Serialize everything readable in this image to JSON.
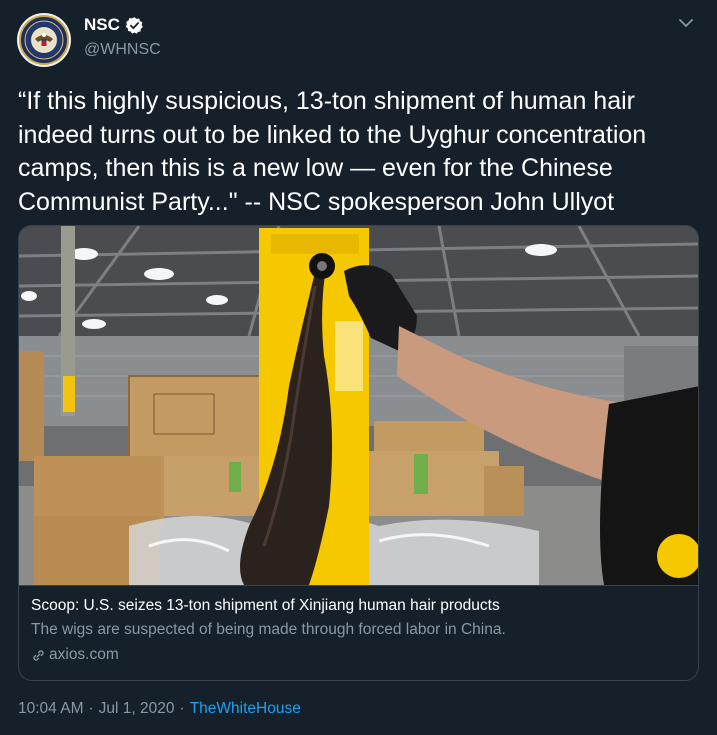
{
  "author": {
    "name": "NSC",
    "handle": "@WHNSC",
    "avatar_icon": "presidential-seal-icon",
    "verified_icon": "verified-badge-icon"
  },
  "tweet": {
    "text": "“If this highly suspicious, 13-ton shipment of human hair indeed turns out to be linked to the Uyghur concentration camps, then this is a new low — even for the Chinese Communist Party...\" -- NSC spokesperson John Ullyot"
  },
  "card": {
    "title": "Scoop: U.S. seizes 13-ton shipment of Xinjiang human hair products",
    "description": "The wigs are suspected of being made through forced labor in China.",
    "domain": "axios.com",
    "image_subject": "warehouse-hair-product-photo"
  },
  "meta": {
    "time": "10:04 AM",
    "separator1": "·",
    "date": "Jul 1, 2020",
    "separator2": "·",
    "source": "TheWhiteHouse"
  },
  "colors": {
    "background": "#15202b",
    "secondary_text": "#8899a6",
    "link": "#1da1f2",
    "border": "#38444d"
  }
}
